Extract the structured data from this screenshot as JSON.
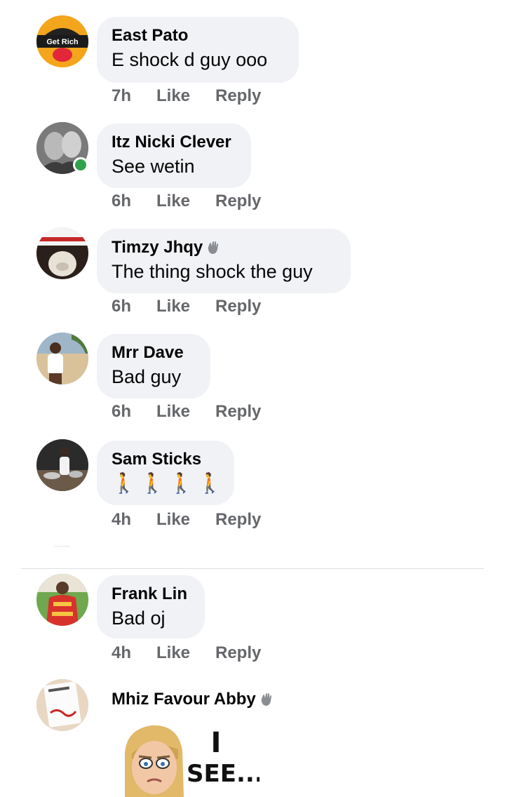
{
  "comments": [
    {
      "avatar_label": "Get Rich",
      "name": "East Pato",
      "text": "E shock d guy ooo",
      "time": "7h",
      "like": "Like",
      "reply": "Reply"
    },
    {
      "name": "Itz Nicki Clever",
      "text": "See wetin",
      "time": "6h",
      "like": "Like",
      "reply": "Reply",
      "online": true
    },
    {
      "name": "Timzy Jhqy",
      "text": "The thing shock the guy",
      "time": "6h",
      "like": "Like",
      "reply": "Reply",
      "badge_icon": "waving-hand-icon"
    },
    {
      "name": "Mrr Dave",
      "text": "Bad guy",
      "time": "6h",
      "like": "Like",
      "reply": "Reply"
    },
    {
      "name": "Sam Sticks",
      "text": "🚶🚶🚶🚶",
      "time": "4h",
      "like": "Like",
      "reply": "Reply"
    },
    {
      "name": "Frank Lin",
      "text": "Bad oj",
      "time": "4h",
      "like": "Like",
      "reply": "Reply"
    },
    {
      "name": "Mhiz Favour Abby",
      "badge_icon": "waving-hand-icon",
      "sticker_text_1": "I",
      "sticker_text_2": "SEE..."
    }
  ],
  "colors": {
    "bubble": "#f0f2f5",
    "name": "#050505",
    "meta": "#65676b",
    "online": "#31a24c"
  }
}
